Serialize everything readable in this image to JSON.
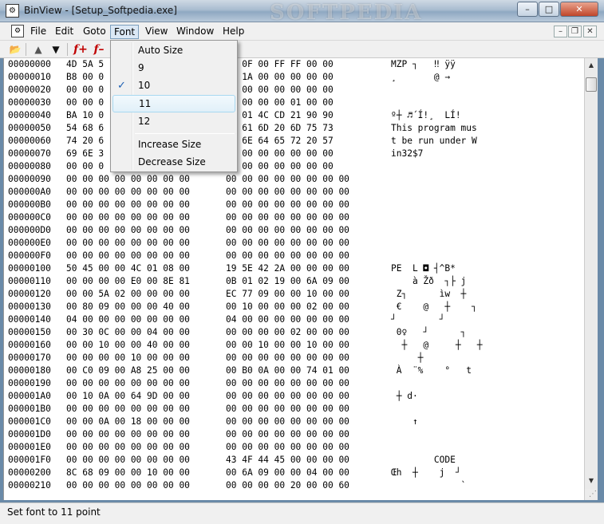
{
  "window": {
    "title": "BinView - [Setup_Softpedia.exe]",
    "watermark": "SOFTPEDIA",
    "min_glyph": "–",
    "max_glyph": "□",
    "close_glyph": "✕"
  },
  "menubar": {
    "items": [
      "File",
      "Edit",
      "Goto",
      "Font",
      "View",
      "Window",
      "Help"
    ],
    "mdi_min": "–",
    "mdi_restore": "❐",
    "mdi_close": "✕"
  },
  "toolbar": {
    "open_glyph": "📂",
    "up_glyph": "▲",
    "down_glyph": "▼",
    "font_plus": "f+",
    "font_minus": "f–"
  },
  "font_menu": {
    "items": [
      "Auto Size",
      "9",
      "10",
      "11",
      "12",
      "Increase Size",
      "Decrease Size"
    ],
    "checked": "10",
    "highlighted": "11",
    "check_glyph": "✓"
  },
  "hex_rows": [
    {
      "off": "00000000",
      "h1": "4D 5A 5",
      "h2": "00 0F 00 FF FF 00 00",
      "asc": "MZP ┐   ‼ ÿÿ"
    },
    {
      "off": "00000010",
      "h1": "B8 00 0",
      "h2": "00 1A 00 00 00 00 00",
      "asc": "¸       @ →"
    },
    {
      "off": "00000020",
      "h1": "00 00 0",
      "h2": "00 00 00 00 00 00 00",
      "asc": ""
    },
    {
      "off": "00000030",
      "h1": "00 00 0",
      "h2": "00 00 00 00 01 00 00",
      "asc": ""
    },
    {
      "off": "00000040",
      "h1": "BA 10 0",
      "h2": "B8 01 4C CD 21 90 90",
      "asc": "º┼ ♬´Í!¸  LÍ!"
    },
    {
      "off": "00000050",
      "h1": "54 68 6",
      "h2": "72 61 6D 20 6D 75 73",
      "asc": "This program mus"
    },
    {
      "off": "00000060",
      "h1": "74 20 6",
      "h2": "75 6E 64 65 72 20 57",
      "asc": "t be run under W"
    },
    {
      "off": "00000070",
      "h1": "69 6E 3",
      "h2": "00 00 00 00 00 00 00",
      "asc": "in32$7"
    },
    {
      "off": "00000080",
      "h1": "00 00 0",
      "h2": "00 00 00 00 00 00 00",
      "asc": ""
    },
    {
      "off": "00000090",
      "h1": "00 00 00 00 00 00 00 00",
      "h2": "00 00 00 00 00 00 00 00",
      "asc": ""
    },
    {
      "off": "000000A0",
      "h1": "00 00 00 00 00 00 00 00",
      "h2": "00 00 00 00 00 00 00 00",
      "asc": ""
    },
    {
      "off": "000000B0",
      "h1": "00 00 00 00 00 00 00 00",
      "h2": "00 00 00 00 00 00 00 00",
      "asc": ""
    },
    {
      "off": "000000C0",
      "h1": "00 00 00 00 00 00 00 00",
      "h2": "00 00 00 00 00 00 00 00",
      "asc": ""
    },
    {
      "off": "000000D0",
      "h1": "00 00 00 00 00 00 00 00",
      "h2": "00 00 00 00 00 00 00 00",
      "asc": ""
    },
    {
      "off": "000000E0",
      "h1": "00 00 00 00 00 00 00 00",
      "h2": "00 00 00 00 00 00 00 00",
      "asc": ""
    },
    {
      "off": "000000F0",
      "h1": "00 00 00 00 00 00 00 00",
      "h2": "00 00 00 00 00 00 00 00",
      "asc": ""
    },
    {
      "off": "00000100",
      "h1": "50 45 00 00 4C 01 08 00",
      "h2": "19 5E 42 2A 00 00 00 00",
      "asc": "PE  L ◘ ┤^B*"
    },
    {
      "off": "00000110",
      "h1": "00 00 00 00 E0 00 8E 81",
      "h2": "0B 01 02 19 00 6A 09 00",
      "asc": "    à Žð  ┐├ j"
    },
    {
      "off": "00000120",
      "h1": "00 00 5A 02 00 00 00 00",
      "h2": "EC 77 09 00 00 10 00 00",
      "asc": " Z┐      ìw  ┼"
    },
    {
      "off": "00000130",
      "h1": "00 80 09 00 00 00 40 00",
      "h2": "00 10 00 00 00 02 00 00",
      "asc": " €    @   ┼    ┐"
    },
    {
      "off": "00000140",
      "h1": "04 00 00 00 00 00 00 00",
      "h2": "04 00 00 00 00 00 00 00",
      "asc": "┘        ┘"
    },
    {
      "off": "00000150",
      "h1": "00 30 0C 00 00 04 00 00",
      "h2": "00 00 00 00 02 00 00 00",
      "asc": " 0♀   ┘      ┐"
    },
    {
      "off": "00000160",
      "h1": "00 00 10 00 00 40 00 00",
      "h2": "00 00 10 00 00 10 00 00",
      "asc": "  ┼   @     ┼   ┼"
    },
    {
      "off": "00000170",
      "h1": "00 00 00 00 10 00 00 00",
      "h2": "00 00 00 00 00 00 00 00",
      "asc": "     ┼"
    },
    {
      "off": "00000180",
      "h1": "00 C0 09 00 A8 25 00 00",
      "h2": "00 B0 0A 00 00 74 01 00",
      "asc": " À  ¨%    °   t"
    },
    {
      "off": "00000190",
      "h1": "00 00 00 00 00 00 00 00",
      "h2": "00 00 00 00 00 00 00 00",
      "asc": ""
    },
    {
      "off": "000001A0",
      "h1": "00 10 0A 00 64 9D 00 00",
      "h2": "00 00 00 00 00 00 00 00",
      "asc": " ┼ d·"
    },
    {
      "off": "000001B0",
      "h1": "00 00 00 00 00 00 00 00",
      "h2": "00 00 00 00 00 00 00 00",
      "asc": ""
    },
    {
      "off": "000001C0",
      "h1": "00 00 0A 00 18 00 00 00",
      "h2": "00 00 00 00 00 00 00 00",
      "asc": "    ↑"
    },
    {
      "off": "000001D0",
      "h1": "00 00 00 00 00 00 00 00",
      "h2": "00 00 00 00 00 00 00 00",
      "asc": ""
    },
    {
      "off": "000001E0",
      "h1": "00 00 00 00 00 00 00 00",
      "h2": "00 00 00 00 00 00 00 00",
      "asc": ""
    },
    {
      "off": "000001F0",
      "h1": "00 00 00 00 00 00 00 00",
      "h2": "43 4F 44 45 00 00 00 00",
      "asc": "        CODE"
    },
    {
      "off": "00000200",
      "h1": "8C 68 09 00 00 10 00 00",
      "h2": "00 6A 09 00 00 04 00 00",
      "asc": "Œh  ┼    j  ┘"
    },
    {
      "off": "00000210",
      "h1": "00 00 00 00 00 00 00 00",
      "h2": "00 00 00 00 20 00 00 60",
      "asc": "             `"
    }
  ],
  "scrollbar": {
    "up_glyph": "▲",
    "down_glyph": "▼",
    "grip_glyph": "⋰"
  },
  "statusbar": {
    "text": "Set font to 11 point"
  }
}
